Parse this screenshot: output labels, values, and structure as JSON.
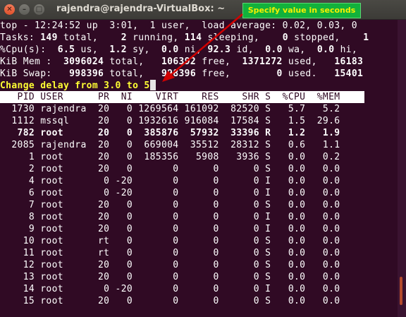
{
  "window": {
    "title": "rajendra@rajendra-VirtualBox: ~",
    "close_glyph": "✕",
    "min_glyph": "–",
    "max_glyph": "□"
  },
  "callout": {
    "text": "Specify value in seconds",
    "bg_color": "#12b23c",
    "text_color": "#f4f000",
    "arrow_color": "#d00000"
  },
  "summary": {
    "line1": "top - 12:24:52 up  3:01,  1 user,  load average: 0.02, 0.03, 0",
    "tasks": {
      "label": "Tasks:",
      "total": "149",
      "total_label": "total,",
      "running": "2",
      "running_label": "running,",
      "sleeping": "114",
      "sleeping_label": "sleeping,",
      "stopped": "0",
      "stopped_label": "stopped,",
      "zombie": "1"
    },
    "cpu": {
      "label": "%Cpu(s):",
      "us": "6.5",
      "us_label": "us,",
      "sy": "1.2",
      "sy_label": "sy,",
      "ni": "0.0",
      "ni_label": "ni,",
      "id": "92.3",
      "id_label": "id,",
      "wa": "0.0",
      "wa_label": "wa,",
      "hi": "0.0",
      "hi_label": "hi,"
    },
    "mem": {
      "label": "KiB Mem :",
      "total": "3096024",
      "total_label": "total,",
      "free": "106392",
      "free_label": "free,",
      "used": "1371272",
      "used_label": "used,",
      "buff": "16183"
    },
    "swap": {
      "label": "KiB Swap:",
      "total": "998396",
      "total_label": "total,",
      "free": "998396",
      "free_label": "free,",
      "used": "0",
      "used_label": "used.",
      "avail": "15401"
    }
  },
  "prompt": {
    "text": "Change delay from 3.0 to ",
    "input_value": "5"
  },
  "table": {
    "headers": [
      "PID",
      "USER",
      "PR",
      "NI",
      "VIRT",
      "RES",
      "SHR",
      "S",
      "%CPU",
      "%MEM"
    ],
    "rows": [
      {
        "pid": "1730",
        "user": "rajendra",
        "pr": "20",
        "ni": "0",
        "virt": "1269564",
        "res": "161092",
        "shr": "82520",
        "s": "S",
        "cpu": "5.7",
        "mem": "5.2",
        "bold": false
      },
      {
        "pid": "1112",
        "user": "mssql",
        "pr": "20",
        "ni": "0",
        "virt": "1932616",
        "res": "916084",
        "shr": "17584",
        "s": "S",
        "cpu": "1.5",
        "mem": "29.6",
        "bold": false
      },
      {
        "pid": "782",
        "user": "root",
        "pr": "20",
        "ni": "0",
        "virt": "385876",
        "res": "57932",
        "shr": "33396",
        "s": "R",
        "cpu": "1.2",
        "mem": "1.9",
        "bold": true
      },
      {
        "pid": "2085",
        "user": "rajendra",
        "pr": "20",
        "ni": "0",
        "virt": "669004",
        "res": "35512",
        "shr": "28312",
        "s": "S",
        "cpu": "0.6",
        "mem": "1.1",
        "bold": false
      },
      {
        "pid": "1",
        "user": "root",
        "pr": "20",
        "ni": "0",
        "virt": "185356",
        "res": "5908",
        "shr": "3936",
        "s": "S",
        "cpu": "0.0",
        "mem": "0.2",
        "bold": false
      },
      {
        "pid": "2",
        "user": "root",
        "pr": "20",
        "ni": "0",
        "virt": "0",
        "res": "0",
        "shr": "0",
        "s": "S",
        "cpu": "0.0",
        "mem": "0.0",
        "bold": false
      },
      {
        "pid": "4",
        "user": "root",
        "pr": "0",
        "ni": "-20",
        "virt": "0",
        "res": "0",
        "shr": "0",
        "s": "I",
        "cpu": "0.0",
        "mem": "0.0",
        "bold": false
      },
      {
        "pid": "6",
        "user": "root",
        "pr": "0",
        "ni": "-20",
        "virt": "0",
        "res": "0",
        "shr": "0",
        "s": "I",
        "cpu": "0.0",
        "mem": "0.0",
        "bold": false
      },
      {
        "pid": "7",
        "user": "root",
        "pr": "20",
        "ni": "0",
        "virt": "0",
        "res": "0",
        "shr": "0",
        "s": "S",
        "cpu": "0.0",
        "mem": "0.0",
        "bold": false
      },
      {
        "pid": "8",
        "user": "root",
        "pr": "20",
        "ni": "0",
        "virt": "0",
        "res": "0",
        "shr": "0",
        "s": "I",
        "cpu": "0.0",
        "mem": "0.0",
        "bold": false
      },
      {
        "pid": "9",
        "user": "root",
        "pr": "20",
        "ni": "0",
        "virt": "0",
        "res": "0",
        "shr": "0",
        "s": "I",
        "cpu": "0.0",
        "mem": "0.0",
        "bold": false
      },
      {
        "pid": "10",
        "user": "root",
        "pr": "rt",
        "ni": "0",
        "virt": "0",
        "res": "0",
        "shr": "0",
        "s": "S",
        "cpu": "0.0",
        "mem": "0.0",
        "bold": false
      },
      {
        "pid": "11",
        "user": "root",
        "pr": "rt",
        "ni": "0",
        "virt": "0",
        "res": "0",
        "shr": "0",
        "s": "S",
        "cpu": "0.0",
        "mem": "0.0",
        "bold": false
      },
      {
        "pid": "12",
        "user": "root",
        "pr": "20",
        "ni": "0",
        "virt": "0",
        "res": "0",
        "shr": "0",
        "s": "S",
        "cpu": "0.0",
        "mem": "0.0",
        "bold": false
      },
      {
        "pid": "13",
        "user": "root",
        "pr": "20",
        "ni": "0",
        "virt": "0",
        "res": "0",
        "shr": "0",
        "s": "S",
        "cpu": "0.0",
        "mem": "0.0",
        "bold": false
      },
      {
        "pid": "14",
        "user": "root",
        "pr": "0",
        "ni": "-20",
        "virt": "0",
        "res": "0",
        "shr": "0",
        "s": "I",
        "cpu": "0.0",
        "mem": "0.0",
        "bold": false
      },
      {
        "pid": "15",
        "user": "root",
        "pr": "20",
        "ni": "0",
        "virt": "0",
        "res": "0",
        "shr": "0",
        "s": "S",
        "cpu": "0.0",
        "mem": "0.0",
        "bold": false
      }
    ]
  },
  "colors": {
    "terminal_bg": "#300a24",
    "terminal_fg": "#ffffff",
    "prompt_fg": "#ffff33",
    "header_bg": "#ffffff"
  }
}
